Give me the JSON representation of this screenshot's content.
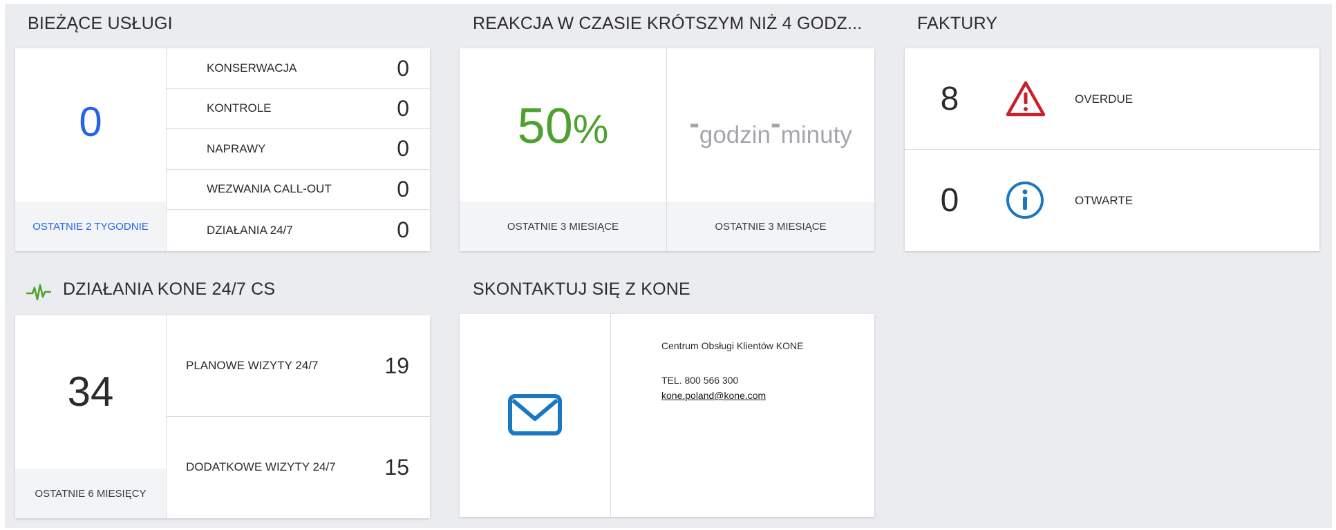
{
  "current_services": {
    "title": "BIEŻĄCE USŁUGI",
    "total": "0",
    "period": "OSTATNIE 2 TYGODNIE",
    "items": [
      {
        "label": "KONSERWACJA",
        "value": "0"
      },
      {
        "label": "KONTROLE",
        "value": "0"
      },
      {
        "label": "NAPRAWY",
        "value": "0"
      },
      {
        "label": "WEZWANIA CALL-OUT",
        "value": "0"
      },
      {
        "label": "DZIAŁANIA 24/7",
        "value": "0"
      }
    ]
  },
  "response": {
    "title": "REAKCJA W CZASIE KRÓTSZYM NIŻ 4 GODZ...",
    "percent_value": "50",
    "percent_sign": "%",
    "hours_dash": "-",
    "hours_label": "godzin",
    "minutes_dash": "-",
    "minutes_label": "minuty",
    "period_left": "OSTATNIE 3 MIESIĄCE",
    "period_right": "OSTATNIE 3 MIESIĄCE"
  },
  "invoices": {
    "title": "FAKTURY",
    "rows": [
      {
        "count": "8",
        "icon": "warning-icon",
        "label": "OVERDUE"
      },
      {
        "count": "0",
        "icon": "info-icon",
        "label": "OTWARTE"
      }
    ]
  },
  "activities": {
    "title": "DZIAŁANIA KONE 24/7 CS",
    "icon": "pulse-icon",
    "total": "34",
    "period": "OSTATNIE 6 MIESIĘCY",
    "items": [
      {
        "label": "PLANOWE WIZYTY 24/7",
        "value": "19"
      },
      {
        "label": "DODATKOWE WIZYTY 24/7",
        "value": "15"
      }
    ]
  },
  "contact": {
    "title": "SKONTAKTUJ SIĘ Z KONE",
    "icon": "mail-icon",
    "center_name": "Centrum Obsługi Klientów KONE",
    "phone": "TEL. 800 566 300",
    "email": "kone.poland@kone.com"
  },
  "colors": {
    "background": "#ebecef",
    "blue_accent": "#2563eb",
    "green_accent": "#4ea12e",
    "warning_red": "#c8222a",
    "info_blue": "#1a78c2",
    "muted_gray": "#a3a7ad"
  }
}
